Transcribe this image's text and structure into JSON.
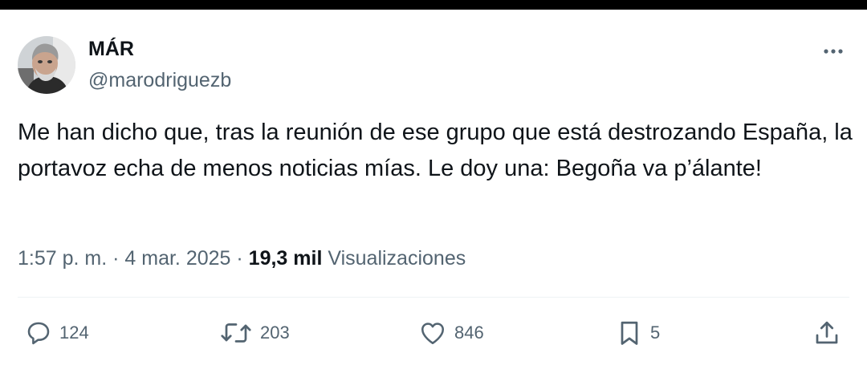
{
  "author": {
    "name": "MÁR",
    "handle": "@marodriguezb"
  },
  "tweet": {
    "text": "Me han dicho que, tras la reunión de ese grupo que está destrozando España, la portavoz echa de menos noticias mías. Le doy una: Begoña va p’álante!",
    "time": "1:57 p. m.",
    "date": "4 mar. 2025",
    "separator": "·",
    "views_count": "19,3 mil",
    "views_label": "Visualizaciones"
  },
  "actions": {
    "replies": "124",
    "reposts": "203",
    "likes": "846",
    "bookmarks": "5"
  },
  "icons": {
    "more": "more-horizontal-icon",
    "reply": "reply-icon",
    "repost": "repost-icon",
    "like": "heart-icon",
    "bookmark": "bookmark-icon",
    "share": "share-icon"
  },
  "colors": {
    "text_primary": "#0f1419",
    "text_secondary": "#536471",
    "divider": "#eff3f4"
  }
}
